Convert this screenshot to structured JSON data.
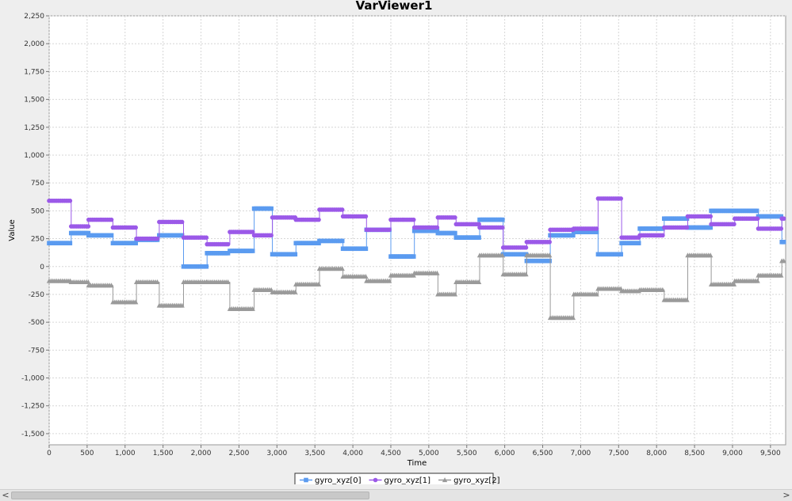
{
  "window": {
    "title": "VarViewer1"
  },
  "scrollbar": {
    "left_arrow": "<",
    "right_arrow": ">",
    "thumb_fraction": 0.465
  },
  "chart_data": {
    "type": "line",
    "title": "VarViewer1",
    "xlabel": "Time",
    "ylabel": "Value",
    "xlim": [
      0,
      9700
    ],
    "ylim": [
      -1600,
      2250
    ],
    "x_ticks": [
      0,
      500,
      1000,
      1500,
      2000,
      2500,
      3000,
      3500,
      4000,
      4500,
      5000,
      5500,
      6000,
      6500,
      7000,
      7500,
      8000,
      8500,
      9000,
      9500
    ],
    "x_tick_labels": [
      "0",
      "500",
      "1,000",
      "1,500",
      "2,000",
      "2,500",
      "3,000",
      "3,500",
      "4,000",
      "4,500",
      "5,000",
      "5,500",
      "6,000",
      "6,500",
      "7,000",
      "7,500",
      "8,000",
      "8,500",
      "9,000",
      "9,500"
    ],
    "y_ticks": [
      2250,
      2000,
      1750,
      1500,
      1250,
      1000,
      750,
      500,
      250,
      0,
      -250,
      -500,
      -750,
      -1000,
      -1250,
      -1500
    ],
    "y_tick_labels": [
      "2,250",
      "2,000",
      "1,750",
      "1,500",
      "1,250",
      "1,000",
      "750",
      "500",
      "250",
      "0",
      "-250",
      "-500",
      "-750",
      "-1,000",
      "-1,250",
      "-1,500"
    ],
    "grid": true,
    "legend_position": "bottom-center",
    "series": [
      {
        "name": "gyro_xyz[0]",
        "color": "#5b9bf0",
        "marker": "square",
        "segments": [
          [
            0,
            290,
            210
          ],
          [
            290,
            520,
            300
          ],
          [
            520,
            840,
            280
          ],
          [
            840,
            1150,
            210
          ],
          [
            1150,
            1450,
            240
          ],
          [
            1450,
            1770,
            280
          ],
          [
            1770,
            2080,
            0
          ],
          [
            2080,
            2380,
            120
          ],
          [
            2380,
            2700,
            140
          ],
          [
            2700,
            2940,
            520
          ],
          [
            2940,
            3250,
            110
          ],
          [
            3250,
            3560,
            210
          ],
          [
            3560,
            3870,
            230
          ],
          [
            3870,
            4180,
            160
          ],
          [
            4180,
            4500,
            330
          ],
          [
            4500,
            4810,
            90
          ],
          [
            4810,
            5120,
            320
          ],
          [
            5120,
            5360,
            300
          ],
          [
            5360,
            5670,
            260
          ],
          [
            5670,
            5980,
            420
          ],
          [
            5980,
            6290,
            110
          ],
          [
            6290,
            6600,
            50
          ],
          [
            6600,
            6910,
            280
          ],
          [
            6910,
            7230,
            310
          ],
          [
            7230,
            7540,
            110
          ],
          [
            7540,
            7780,
            210
          ],
          [
            7780,
            8100,
            340
          ],
          [
            8100,
            8410,
            430
          ],
          [
            8410,
            8720,
            350
          ],
          [
            8720,
            9340,
            500
          ],
          [
            9340,
            9650,
            450
          ],
          [
            9650,
            9700,
            220
          ]
        ]
      },
      {
        "name": "gyro_xyz[1]",
        "color": "#9b59e8",
        "marker": "circle",
        "segments": [
          [
            0,
            290,
            590
          ],
          [
            290,
            520,
            360
          ],
          [
            520,
            840,
            420
          ],
          [
            840,
            1150,
            350
          ],
          [
            1150,
            1450,
            250
          ],
          [
            1450,
            1770,
            400
          ],
          [
            1770,
            2080,
            260
          ],
          [
            2080,
            2380,
            200
          ],
          [
            2380,
            2700,
            310
          ],
          [
            2700,
            2940,
            280
          ],
          [
            2940,
            3250,
            440
          ],
          [
            3250,
            3560,
            420
          ],
          [
            3560,
            3870,
            510
          ],
          [
            3870,
            4180,
            450
          ],
          [
            4180,
            4500,
            330
          ],
          [
            4500,
            4810,
            420
          ],
          [
            4810,
            5120,
            350
          ],
          [
            5120,
            5360,
            440
          ],
          [
            5360,
            5670,
            380
          ],
          [
            5670,
            5980,
            350
          ],
          [
            5980,
            6290,
            170
          ],
          [
            6290,
            6600,
            220
          ],
          [
            6600,
            6910,
            330
          ],
          [
            6910,
            7230,
            340
          ],
          [
            7230,
            7540,
            610
          ],
          [
            7540,
            7780,
            260
          ],
          [
            7780,
            8100,
            280
          ],
          [
            8100,
            8410,
            350
          ],
          [
            8410,
            8720,
            450
          ],
          [
            8720,
            9030,
            380
          ],
          [
            9030,
            9340,
            430
          ],
          [
            9340,
            9650,
            340
          ],
          [
            9650,
            9700,
            430
          ]
        ]
      },
      {
        "name": "gyro_xyz[2]",
        "color": "#9a9a9a",
        "marker": "triangle",
        "segments": [
          [
            0,
            290,
            -130
          ],
          [
            290,
            520,
            -140
          ],
          [
            520,
            840,
            -170
          ],
          [
            840,
            1150,
            -320
          ],
          [
            1150,
            1450,
            -140
          ],
          [
            1450,
            1770,
            -350
          ],
          [
            1770,
            2080,
            -140
          ],
          [
            2080,
            2380,
            -140
          ],
          [
            2380,
            2700,
            -380
          ],
          [
            2700,
            2940,
            -210
          ],
          [
            2940,
            3250,
            -230
          ],
          [
            3250,
            3560,
            -160
          ],
          [
            3560,
            3870,
            -20
          ],
          [
            3870,
            4180,
            -90
          ],
          [
            4180,
            4500,
            -130
          ],
          [
            4500,
            4810,
            -80
          ],
          [
            4810,
            5120,
            -60
          ],
          [
            5120,
            5360,
            -250
          ],
          [
            5360,
            5670,
            -140
          ],
          [
            5670,
            5980,
            100
          ],
          [
            5980,
            6290,
            -70
          ],
          [
            6290,
            6600,
            100
          ],
          [
            6600,
            6910,
            -460
          ],
          [
            6910,
            7230,
            -250
          ],
          [
            7230,
            7540,
            -200
          ],
          [
            7540,
            7780,
            -220
          ],
          [
            7780,
            8100,
            -210
          ],
          [
            8100,
            8410,
            -300
          ],
          [
            8410,
            8720,
            100
          ],
          [
            8720,
            9030,
            -160
          ],
          [
            9030,
            9340,
            -130
          ],
          [
            9340,
            9650,
            -80
          ],
          [
            9650,
            9700,
            50
          ]
        ]
      }
    ]
  }
}
